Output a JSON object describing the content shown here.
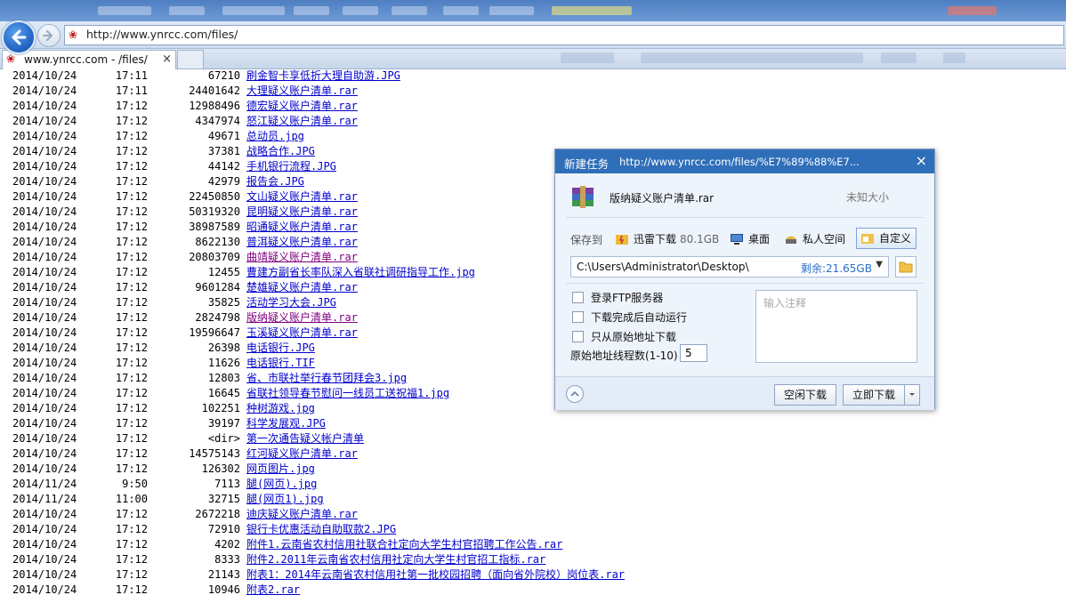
{
  "browser": {
    "url": "http://www.ynrcc.com/files/",
    "tab_title": "www.ynrcc.com - /files/",
    "tab_close": "×"
  },
  "listing": [
    {
      "date": "2014/10/24",
      "time": "17:11",
      "size": "67210",
      "name": "刷金智卡享低折大理自助游.JPG",
      "visited": false
    },
    {
      "date": "2014/10/24",
      "time": "17:11",
      "size": "24401642",
      "name": "大理疑义账户清单.rar",
      "visited": false
    },
    {
      "date": "2014/10/24",
      "time": "17:12",
      "size": "12988496",
      "name": "德宏疑义账户清单.rar",
      "visited": false
    },
    {
      "date": "2014/10/24",
      "time": "17:12",
      "size": "4347974",
      "name": "怒江疑义账户清单.rar",
      "visited": false
    },
    {
      "date": "2014/10/24",
      "time": "17:12",
      "size": "49671",
      "name": "总动员.jpg",
      "visited": false
    },
    {
      "date": "2014/10/24",
      "time": "17:12",
      "size": "37381",
      "name": "战略合作.JPG",
      "visited": false
    },
    {
      "date": "2014/10/24",
      "time": "17:12",
      "size": "44142",
      "name": "手机银行流程.JPG",
      "visited": false
    },
    {
      "date": "2014/10/24",
      "time": "17:12",
      "size": "42979",
      "name": "报告会.JPG",
      "visited": false
    },
    {
      "date": "2014/10/24",
      "time": "17:12",
      "size": "22450850",
      "name": "文山疑义账户清单.rar",
      "visited": false
    },
    {
      "date": "2014/10/24",
      "time": "17:12",
      "size": "50319320",
      "name": "昆明疑义账户清单.rar",
      "visited": false
    },
    {
      "date": "2014/10/24",
      "time": "17:12",
      "size": "38987589",
      "name": "昭通疑义账户清单.rar",
      "visited": false
    },
    {
      "date": "2014/10/24",
      "time": "17:12",
      "size": "8622130",
      "name": "普洱疑义账户清单.rar",
      "visited": false
    },
    {
      "date": "2014/10/24",
      "time": "17:12",
      "size": "20803709",
      "name": "曲靖疑义账户清单.rar",
      "visited": true
    },
    {
      "date": "2014/10/24",
      "time": "17:12",
      "size": "12455",
      "name": "曹建方副省长率队深入省联社调研指导工作.jpg",
      "visited": false
    },
    {
      "date": "2014/10/24",
      "time": "17:12",
      "size": "9601284",
      "name": "楚雄疑义账户清单.rar",
      "visited": false
    },
    {
      "date": "2014/10/24",
      "time": "17:12",
      "size": "35825",
      "name": "活动学习大会.JPG",
      "visited": false
    },
    {
      "date": "2014/10/24",
      "time": "17:12",
      "size": "2824798",
      "name": "版纳疑义账户清单.rar",
      "visited": true
    },
    {
      "date": "2014/10/24",
      "time": "17:12",
      "size": "19596647",
      "name": "玉溪疑义账户清单.rar",
      "visited": false
    },
    {
      "date": "2014/10/24",
      "time": "17:12",
      "size": "26398",
      "name": "电话银行.JPG",
      "visited": false
    },
    {
      "date": "2014/10/24",
      "time": "17:12",
      "size": "11626",
      "name": "电话银行.TIF",
      "visited": false
    },
    {
      "date": "2014/10/24",
      "time": "17:12",
      "size": "12803",
      "name": "省、市联社举行春节团拜会3.jpg",
      "visited": false
    },
    {
      "date": "2014/10/24",
      "time": "17:12",
      "size": "16645",
      "name": "省联社领导春节慰问一线员工送祝福1.jpg",
      "visited": false
    },
    {
      "date": "2014/10/24",
      "time": "17:12",
      "size": "102251",
      "name": "种树游戏.jpg",
      "visited": false
    },
    {
      "date": "2014/10/24",
      "time": "17:12",
      "size": "39197",
      "name": "科学发展观.JPG",
      "visited": false
    },
    {
      "date": "2014/10/24",
      "time": "17:12",
      "size": "<dir>",
      "name": "第一次通告疑义帐户清单",
      "visited": false
    },
    {
      "date": "2014/10/24",
      "time": "17:12",
      "size": "14575143",
      "name": "红河疑义账户清单.rar",
      "visited": false
    },
    {
      "date": "2014/10/24",
      "time": "17:12",
      "size": "126302",
      "name": "网页图片.jpg",
      "visited": false
    },
    {
      "date": "2014/11/24",
      "time": "9:50",
      "size": "7113",
      "name": "腿(网页).jpg",
      "visited": false
    },
    {
      "date": "2014/11/24",
      "time": "11:00",
      "size": "32715",
      "name": "腿(网页1).jpg",
      "visited": false
    },
    {
      "date": "2014/10/24",
      "time": "17:12",
      "size": "2672218",
      "name": "迪庆疑义账户清单.rar",
      "visited": false
    },
    {
      "date": "2014/10/24",
      "time": "17:12",
      "size": "72910",
      "name": "银行卡优惠活动自助取款2.JPG",
      "visited": false
    },
    {
      "date": "2014/10/24",
      "time": "17:12",
      "size": "4202",
      "name": "附件1.云南省农村信用社联合社定向大学生村官招聘工作公告.rar",
      "visited": false
    },
    {
      "date": "2014/10/24",
      "time": "17:12",
      "size": "8333",
      "name": "附件2.2011年云南省农村信用社定向大学生村官招工指标.rar",
      "visited": false
    },
    {
      "date": "2014/10/24",
      "time": "17:12",
      "size": "21143",
      "name": "附表1：2014年云南省农村信用社第一批校园招聘（面向省外院校）岗位表.rar",
      "visited": false
    },
    {
      "date": "2014/10/24",
      "time": "17:12",
      "size": "10946",
      "name": "附表2.rar",
      "visited": false
    }
  ],
  "dialog": {
    "title": "新建任务",
    "title_url": "http://www.ynrcc.com/files/%E7%89%88%E7...",
    "file_name": "版纳疑义账户清单.rar",
    "file_size": "未知大小",
    "save_to_label": "保存到",
    "options": [
      {
        "label": "迅雷下载",
        "size": "80.1GB",
        "icon": "thunder-folder-icon"
      },
      {
        "label": "桌面",
        "size": "",
        "icon": "desktop-icon"
      },
      {
        "label": "私人空间",
        "size": "",
        "icon": "private-space-icon"
      },
      {
        "label": "自定义",
        "size": "",
        "icon": "custom-folder-icon"
      }
    ],
    "path": "C:\\Users\\Administrator\\Desktop\\",
    "free_space": "剩余:21.65GB",
    "checkboxes": [
      "登录FTP服务器",
      "下载完成后自动运行",
      "只从原始地址下载"
    ],
    "threads_label": "原始地址线程数(1-10)",
    "threads_value": "5",
    "note_placeholder": "输入注释",
    "idle_button": "空闲下载",
    "download_button": "立即下载",
    "close": "×"
  }
}
